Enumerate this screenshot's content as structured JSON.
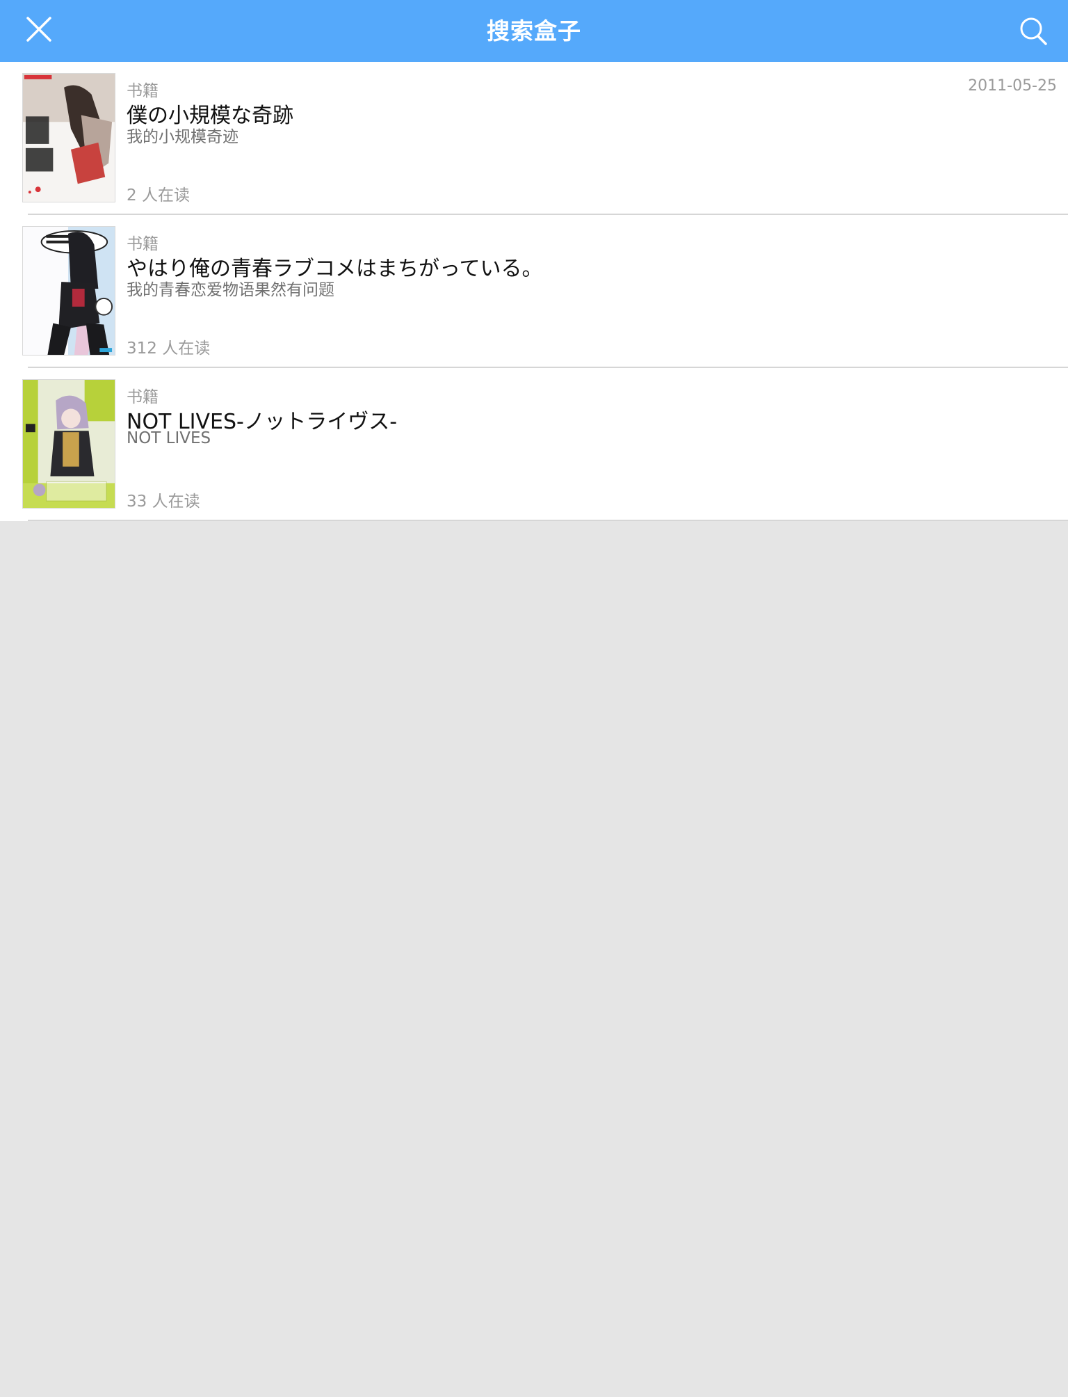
{
  "header": {
    "title": "搜索盒子",
    "close_icon": "close-icon",
    "search_icon": "search-icon",
    "background_color": "#55a9fb"
  },
  "results": [
    {
      "category": "书籍",
      "date": "2011-05-25",
      "title": "僕の小規模な奇跡",
      "subtitle": "我的小规模奇迹",
      "readers": "2 人在读",
      "cover_icon": "book-cover-1"
    },
    {
      "category": "书籍",
      "date": "",
      "title": "やはり俺の青春ラブコメはまちがっている。",
      "subtitle": "我的青春恋爱物语果然有问题",
      "readers": "312 人在读",
      "cover_icon": "book-cover-2"
    },
    {
      "category": "书籍",
      "date": "",
      "title": "NOT LIVES-ノットライヴス-",
      "subtitle": "NOT LIVES",
      "readers": "33 人在读",
      "cover_icon": "book-cover-3"
    }
  ]
}
